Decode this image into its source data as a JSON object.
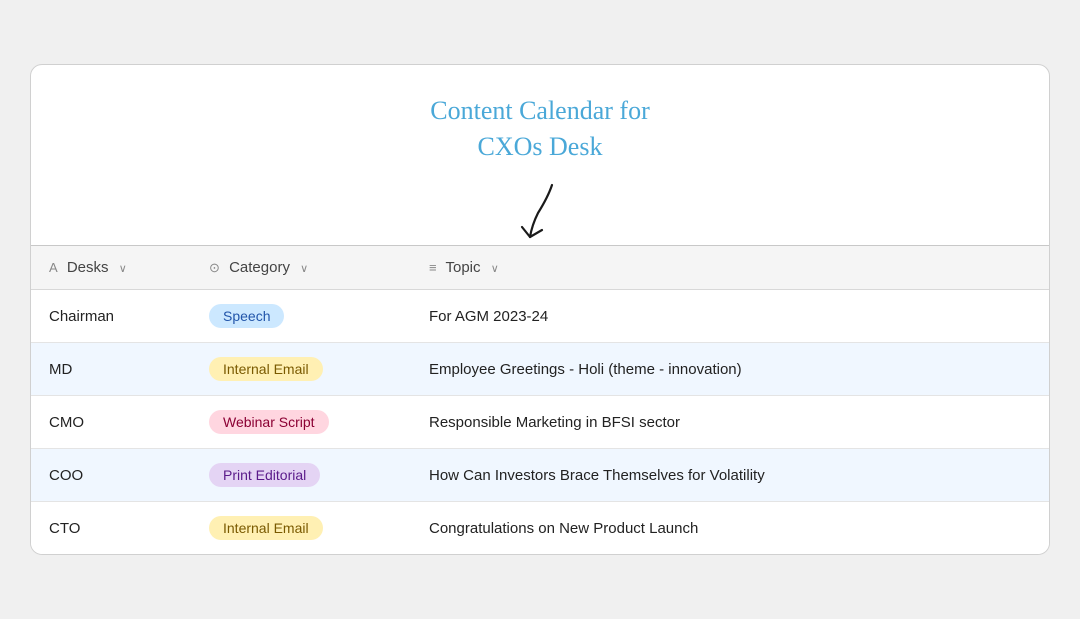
{
  "title": {
    "line1": "Content Calendar for",
    "line2": "CXOs Desk"
  },
  "table": {
    "columns": [
      {
        "id": "desks",
        "icon": "A",
        "label": "Desks",
        "has_chevron": true
      },
      {
        "id": "category",
        "icon": "⊙",
        "label": "Category",
        "has_chevron": true
      },
      {
        "id": "topic",
        "icon": "≡",
        "label": "Topic",
        "has_chevron": true
      }
    ],
    "rows": [
      {
        "desk": "Chairman",
        "category_label": "Speech",
        "category_class": "badge-speech",
        "topic": "For AGM 2023-24"
      },
      {
        "desk": "MD",
        "category_label": "Internal Email",
        "category_class": "badge-internal-email",
        "topic": "Employee Greetings - Holi (theme - innovation)"
      },
      {
        "desk": "CMO",
        "category_label": "Webinar Script",
        "category_class": "badge-webinar-script",
        "topic": "Responsible Marketing in BFSI sector"
      },
      {
        "desk": "COO",
        "category_label": "Print Editorial",
        "category_class": "badge-print-editorial",
        "topic": "How Can Investors Brace Themselves for Volatility"
      },
      {
        "desk": "CTO",
        "category_label": "Internal Email",
        "category_class": "badge-internal-email",
        "topic": "Congratulations on New Product Launch"
      }
    ]
  }
}
